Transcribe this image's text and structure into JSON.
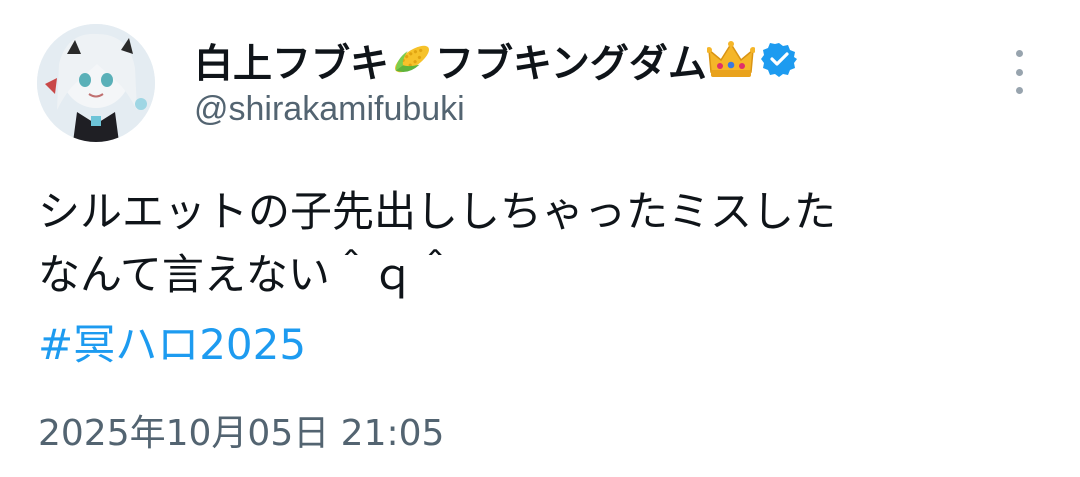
{
  "author": {
    "display_name_part1": "白上フブキ",
    "display_name_part2": "フブキングダム",
    "handle": "@shirakamifubuki",
    "avatar_icon": "avatar-image",
    "verified_icon": "verified-badge-icon",
    "name_emojis": [
      "corn-emoji",
      "crown-emoji"
    ]
  },
  "tweet": {
    "text_line1": "シルエットの子先出ししちゃったミスした",
    "text_line2": "なんて言えない＾ｑ＾",
    "hashtag": "#冥ハロ2025",
    "timestamp": "2025年10月05日 21:05"
  },
  "colors": {
    "text": "#0f1419",
    "secondary": "#536471",
    "link": "#1d9bf0",
    "verified": "#1d9bf0"
  },
  "menu": {
    "icon": "more-vertical-icon"
  }
}
